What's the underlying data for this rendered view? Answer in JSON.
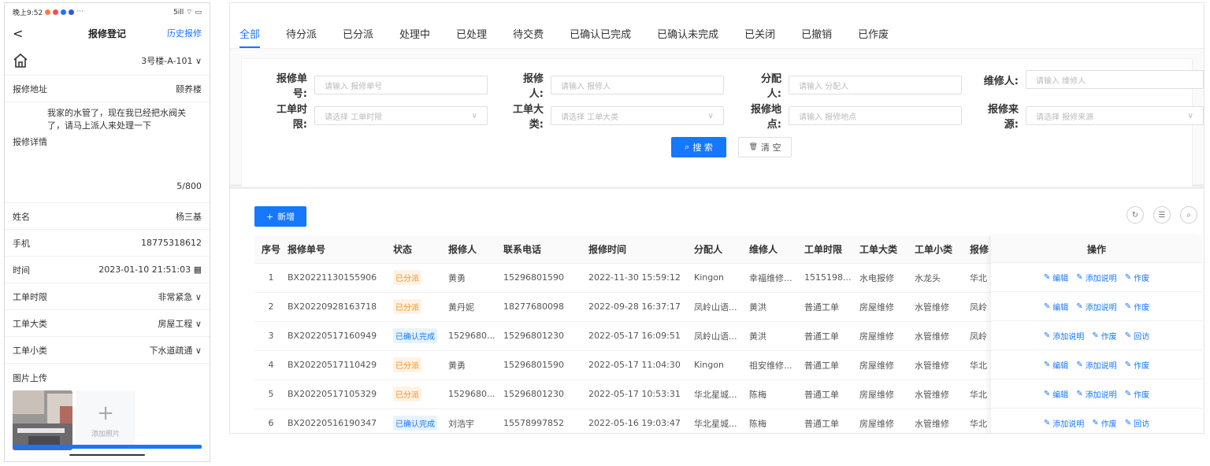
{
  "phone": {
    "status_time": "晚上9:52",
    "status_right": "5ill ⌔ ▭",
    "nav": {
      "back": "<",
      "title": "报修登记",
      "history": "历史报修"
    },
    "house_select": "3号楼-A-101 ∨",
    "address": {
      "label": "报修地址",
      "value": "颐养楼"
    },
    "detail": {
      "text": "我家的水管了，现在我已经把水阀关了，请马上派人来处理一下",
      "label": "报修详情",
      "count": "5/800"
    },
    "name": {
      "label": "姓名",
      "value": "杨三基"
    },
    "phone": {
      "label": "手机",
      "value": "18775318612"
    },
    "time": {
      "label": "时间",
      "value": "2023-01-10 21:51:03 ▦"
    },
    "time_limit": {
      "label": "工单时限",
      "value": "非常紧急 ∨"
    },
    "category": {
      "label": "工单大类",
      "value": "房屋工程 ∨"
    },
    "subcategory": {
      "label": "工单小类",
      "value": "下水道疏通 ∨"
    },
    "upload": {
      "label": "图片上传",
      "add_label": "添加照片",
      "plus": "+"
    }
  },
  "admin": {
    "tabs": [
      "全部",
      "待分派",
      "已分派",
      "处理中",
      "已处理",
      "待交费",
      "已确认已完成",
      "已确认未完成",
      "已关闭",
      "已撤销",
      "已作废"
    ],
    "fields": {
      "order_no": {
        "label": "报修单号:",
        "placeholder": "请输入 报修单号"
      },
      "reporter": {
        "label": "报修人:",
        "placeholder": "请输入 报修人"
      },
      "assigner": {
        "label": "分配人:",
        "placeholder": "请输入 分配人"
      },
      "repairer": {
        "label": "维修人:",
        "placeholder": "请输入 维修人"
      },
      "time_limit": {
        "label": "工单时限:",
        "placeholder": "请选择 工单时限"
      },
      "category": {
        "label": "工单大类:",
        "placeholder": "请选择 工单大类"
      },
      "location": {
        "label": "报修地点:",
        "placeholder": "请输入 报修地点"
      },
      "source": {
        "label": "报修来源:",
        "placeholder": "请选择 报修来源"
      }
    },
    "buttons": {
      "search": "搜 索",
      "clear": "清 空",
      "add": "新增",
      "search_icon": "⌕",
      "clear_icon": "🗑",
      "add_icon": "+"
    },
    "toolbar_icons": [
      "refresh-icon",
      "filter-icon",
      "search-icon"
    ],
    "table": {
      "headers": [
        "序号",
        "报修单号",
        "状态",
        "报修人",
        "联系电话",
        "报修时间",
        "分配人",
        "维修人",
        "工单时限",
        "工单大类",
        "工单小类",
        "报修"
      ],
      "ops_header": "操作",
      "rows": [
        {
          "no": "1",
          "order": "BX20221130155906",
          "status": "已分派",
          "status_type": "orange",
          "reporter": "黄勇",
          "tel": "15296801590",
          "time": "2022-11-30 15:59:12",
          "assigner": "Kingon",
          "repairer": "幸福维修...",
          "limit": "1515198...",
          "cat": "水电报修",
          "sub": "水龙头",
          "loc": "华北",
          "ops": [
            "编辑",
            "添加说明",
            "作废"
          ]
        },
        {
          "no": "2",
          "order": "BX20220928163718",
          "status": "已分派",
          "status_type": "orange",
          "reporter": "黄丹妮",
          "tel": "18277680098",
          "time": "2022-09-28 16:37:17",
          "assigner": "凤岭山语...",
          "repairer": "黄洪",
          "limit": "普通工单",
          "cat": "房屋维修",
          "sub": "水管维修",
          "loc": "凤岭",
          "ops": [
            "编辑",
            "添加说明",
            "作废"
          ]
        },
        {
          "no": "3",
          "order": "BX20220517160949",
          "status": "已确认完成",
          "status_type": "blue",
          "reporter": "1529680...",
          "tel": "15296801230",
          "time": "2022-05-17 16:09:51",
          "assigner": "凤岭山语...",
          "repairer": "黄洪",
          "limit": "普通工单",
          "cat": "房屋维修",
          "sub": "水管维修",
          "loc": "凤岭",
          "ops": [
            "添加说明",
            "作废",
            "回访"
          ]
        },
        {
          "no": "4",
          "order": "BX20220517110429",
          "status": "已分派",
          "status_type": "orange",
          "reporter": "黄勇",
          "tel": "15296801590",
          "time": "2022-05-17 11:04:30",
          "assigner": "Kingon",
          "repairer": "祖安维修...",
          "limit": "普通工单",
          "cat": "房屋维修",
          "sub": "水管维修",
          "loc": "华北",
          "ops": [
            "编辑",
            "添加说明",
            "作废"
          ]
        },
        {
          "no": "5",
          "order": "BX20220517105329",
          "status": "已分派",
          "status_type": "orange",
          "reporter": "1529680...",
          "tel": "15296801230",
          "time": "2022-05-17 10:53:31",
          "assigner": "华北星城...",
          "repairer": "陈梅",
          "limit": "普通工单",
          "cat": "房屋维修",
          "sub": "水管维修",
          "loc": "华北",
          "ops": [
            "编辑",
            "添加说明",
            "作废"
          ]
        },
        {
          "no": "6",
          "order": "BX20220516190347",
          "status": "已确认完成",
          "status_type": "blue",
          "reporter": "刘浩宇",
          "tel": "15578997852",
          "time": "2022-05-16 19:03:47",
          "assigner": "华北星城...",
          "repairer": "陈梅",
          "limit": "普通工单",
          "cat": "房屋维修",
          "sub": "水管维修",
          "loc": "华北",
          "ops": [
            "添加说明",
            "作废",
            "回访"
          ]
        }
      ]
    }
  },
  "colors": {
    "primary": "#1677ff",
    "orange_bg": "#fff3e6",
    "orange_text": "#fa8c16",
    "blue_bg": "#e8f3ff",
    "blue_text": "#1677ff"
  }
}
